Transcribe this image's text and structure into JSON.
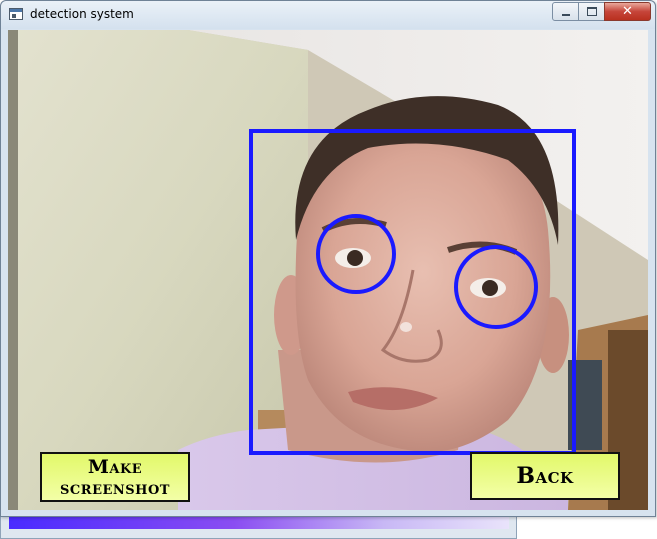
{
  "window": {
    "title": "detection system",
    "controls": {
      "minimize": "minimize",
      "maximize": "maximize",
      "close": "close"
    }
  },
  "camera_feed": {
    "detections": {
      "face_box_color": "#1a1aff",
      "eye_circle_color": "#1a1aff",
      "face_count": 1,
      "eye_count": 2
    }
  },
  "buttons": {
    "screenshot_label": "Make screenshot",
    "back_label": "Back",
    "color": "#ecfc8a"
  },
  "background_window": {
    "progress_gradient": [
      "#4a2bff",
      "#8a4df2",
      "#e9e3fb"
    ]
  }
}
